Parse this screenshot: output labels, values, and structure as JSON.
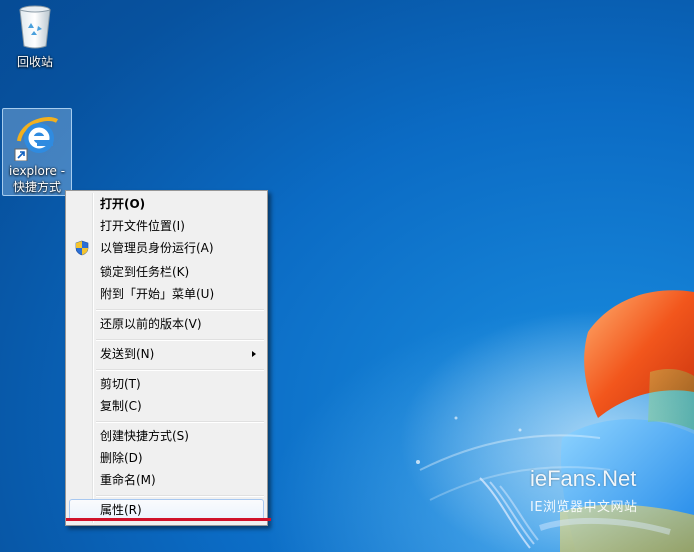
{
  "desktop": {
    "icons": [
      {
        "label": "回收站",
        "icon": "recycle-bin-icon"
      },
      {
        "label_line1": "iexplore -",
        "label_line2": "快捷方式",
        "icon": "internet-explorer-icon"
      }
    ]
  },
  "context_menu": {
    "items": [
      {
        "label": "打开(O)",
        "bold": true
      },
      {
        "label": "打开文件位置(I)"
      },
      {
        "label": "以管理员身份运行(A)",
        "icon": "uac-shield-icon"
      },
      {
        "label": "锁定到任务栏(K)"
      },
      {
        "label": "附到「开始」菜单(U)"
      },
      {
        "label": "还原以前的版本(V)"
      },
      {
        "label": "发送到(N)",
        "submenu": true
      },
      {
        "label": "剪切(T)"
      },
      {
        "label": "复制(C)"
      },
      {
        "label": "创建快捷方式(S)"
      },
      {
        "label": "删除(D)"
      },
      {
        "label": "重命名(M)"
      },
      {
        "label": "属性(R)",
        "highlighted": true
      }
    ]
  },
  "watermark": {
    "title": "ieFans.Net",
    "subtitle": "IE浏览器中文网站"
  },
  "colors": {
    "desktop_blue": "#0b6bc4",
    "menu_bg": "#f0f0f0",
    "highlight_border": "#a8c8f0",
    "annotation_red": "#d0122a"
  }
}
